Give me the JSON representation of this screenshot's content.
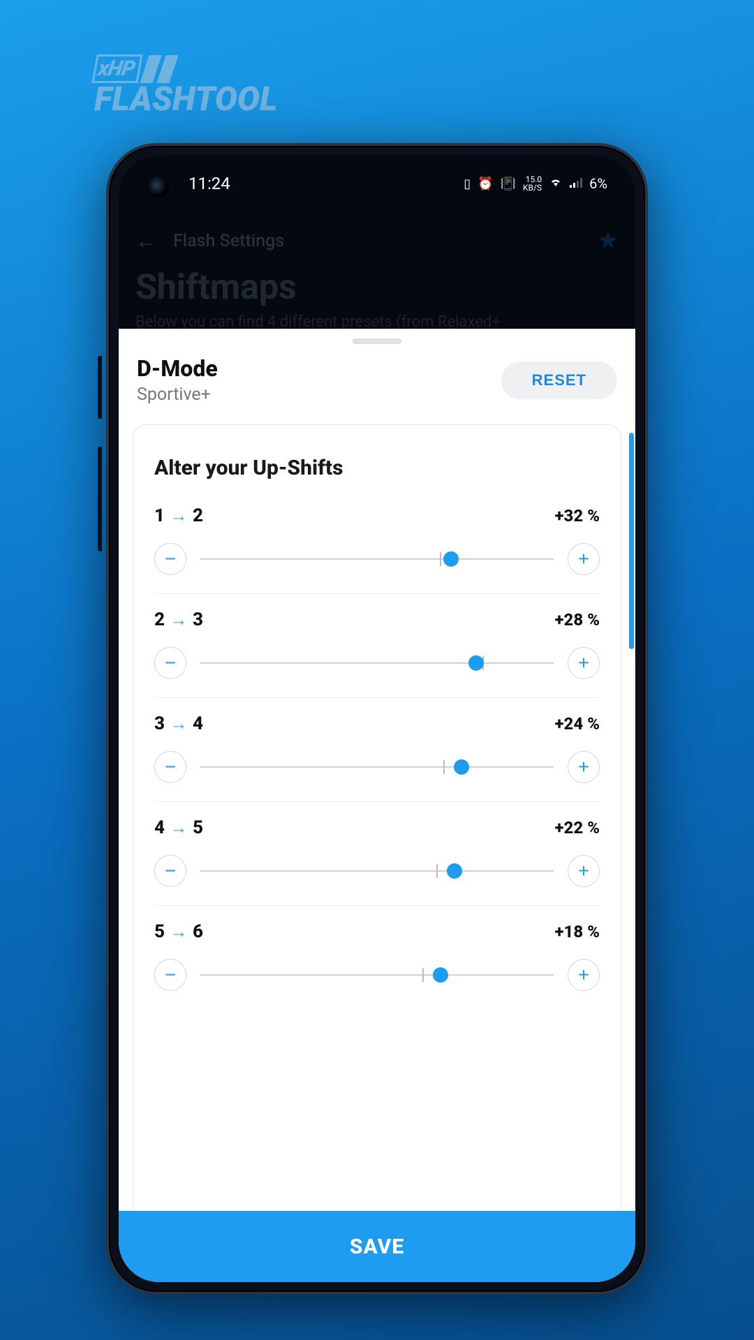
{
  "brand": {
    "tag": "xHP",
    "name": "FLASHTOOL"
  },
  "statusbar": {
    "time": "11:24",
    "speed_top": "15.0",
    "speed_bottom": "KB/S",
    "battery": "6%"
  },
  "toolbar": {
    "title": "Flash Settings"
  },
  "page": {
    "title": "Shiftmaps",
    "desc": "Below you can find 4 different presets (from Relaxed+"
  },
  "sheet": {
    "title": "D-Mode",
    "subtitle": "Sportive+",
    "reset_label": "RESET",
    "card_title": "Alter your Up-Shifts"
  },
  "shifts": [
    {
      "from": "1",
      "to": "2",
      "pct": "+32 %",
      "pos": 71,
      "tick": 68
    },
    {
      "from": "2",
      "to": "3",
      "pct": "+28 %",
      "pos": 78,
      "tick": 80
    },
    {
      "from": "3",
      "to": "4",
      "pct": "+24 %",
      "pos": 74,
      "tick": 69
    },
    {
      "from": "4",
      "to": "5",
      "pct": "+22 %",
      "pos": 72,
      "tick": 67
    },
    {
      "from": "5",
      "to": "6",
      "pct": "+18 %",
      "pos": 68,
      "tick": 63
    }
  ],
  "save_label": "SAVE"
}
